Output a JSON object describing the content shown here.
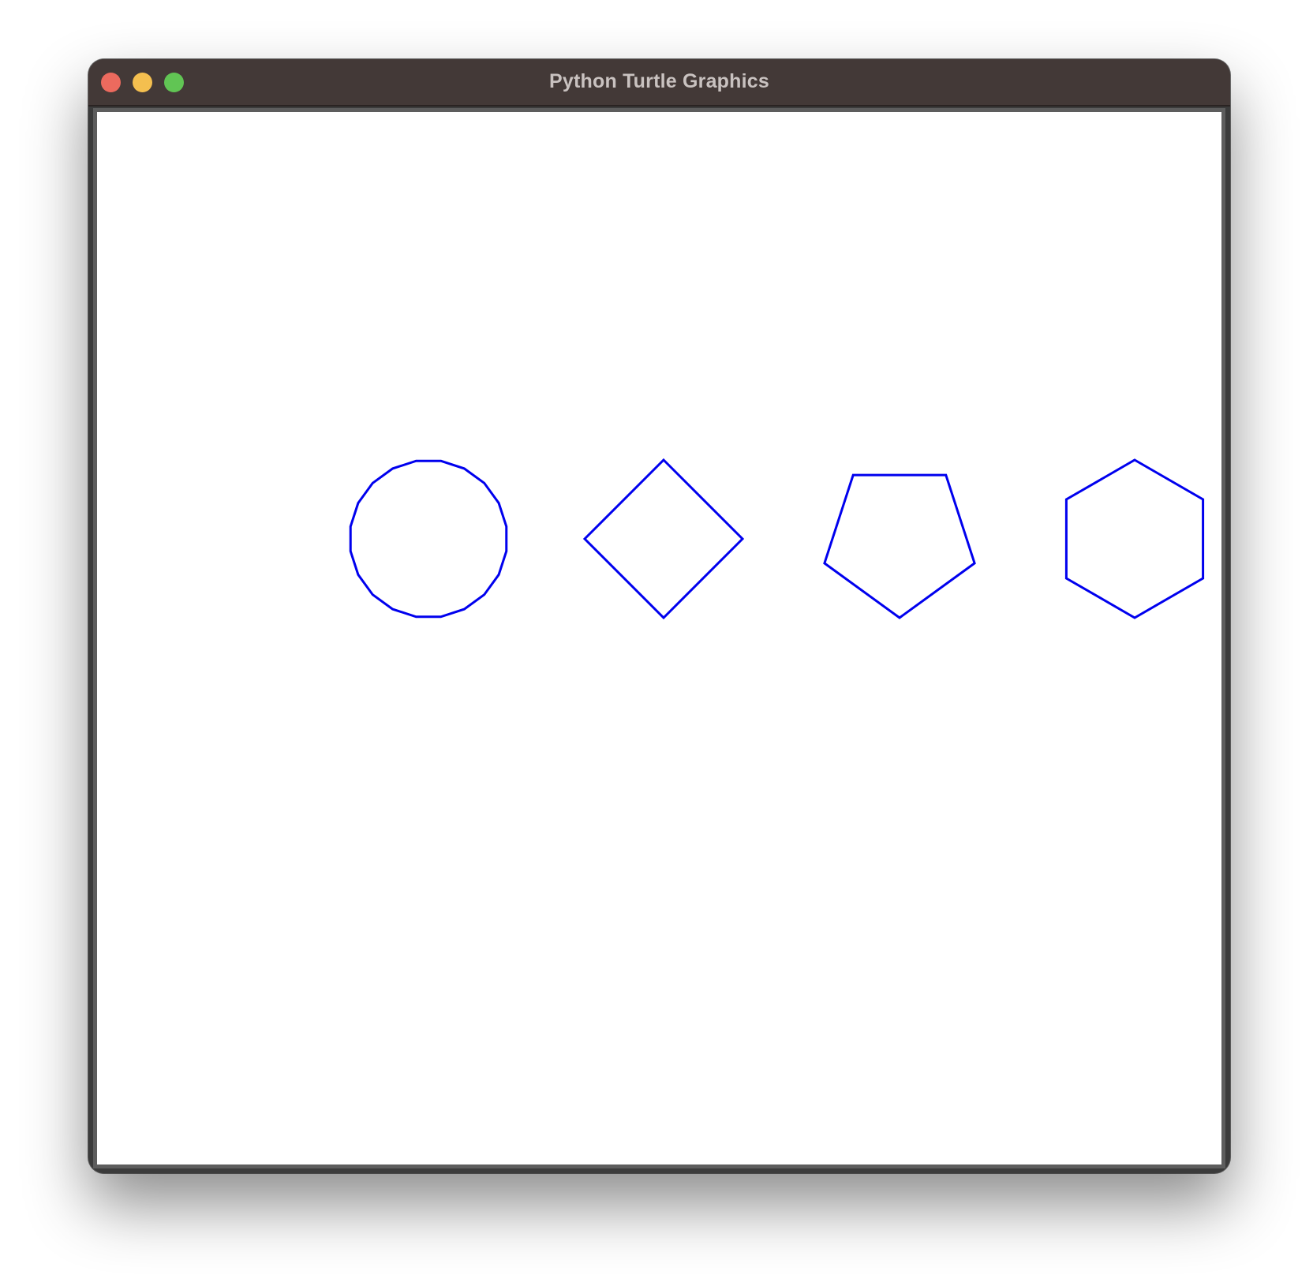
{
  "window": {
    "title": "Python Turtle Graphics",
    "controls": {
      "close_color": "#ec6a5e",
      "minimize_color": "#f4bf4f",
      "maximize_color": "#61c554"
    }
  },
  "canvas": {
    "background": "#ffffff",
    "stroke_color": "#0000ee",
    "shapes": [
      {
        "name": "circle-20-gon",
        "sides": 20,
        "rotation_deg": 9
      },
      {
        "name": "diamond-square",
        "sides": 4,
        "rotation_deg": 0
      },
      {
        "name": "pentagon",
        "sides": 5,
        "rotation_deg": 36
      },
      {
        "name": "hexagon",
        "sides": 6,
        "rotation_deg": 0
      }
    ]
  }
}
